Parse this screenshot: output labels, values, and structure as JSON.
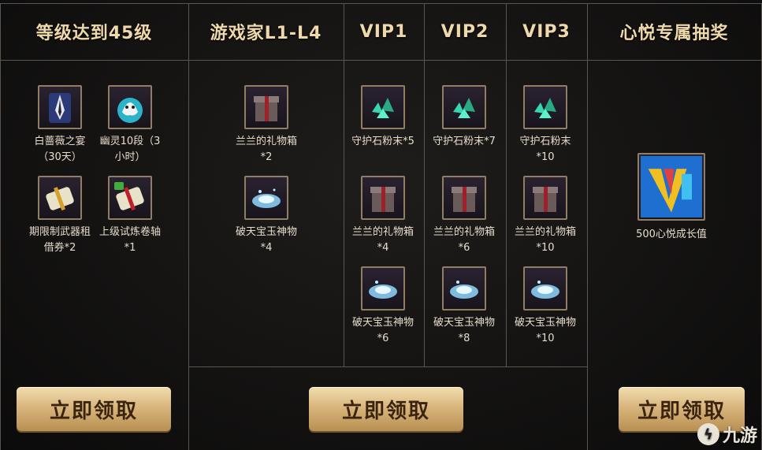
{
  "headers": [
    "等级达到45级",
    "游戏家L1-L4",
    "VIP1",
    "VIP2",
    "VIP3",
    "心悦专属抽奖"
  ],
  "col_level": {
    "items": [
      {
        "icon": "suit-icon",
        "label": "白蔷薇之宴（30天）"
      },
      {
        "icon": "ghost-icon",
        "label": "幽灵10段（3小时）"
      },
      {
        "icon": "scroll-icon",
        "label": "期限制武器租借券*2"
      },
      {
        "icon": "scroll-icon",
        "label": "上级试炼卷轴*1"
      }
    ]
  },
  "col_gamer": {
    "items": [
      {
        "icon": "giftbox-icon",
        "label": "兰兰的礼物箱*2"
      },
      {
        "icon": "jade-icon",
        "label": "破天宝玉神物*4"
      }
    ]
  },
  "col_vip1": {
    "items": [
      {
        "icon": "crystal-icon",
        "label": "守护石粉末*5"
      },
      {
        "icon": "giftbox-icon",
        "label": "兰兰的礼物箱*4"
      },
      {
        "icon": "jade-icon",
        "label": "破天宝玉神物*6"
      }
    ]
  },
  "col_vip2": {
    "items": [
      {
        "icon": "crystal-icon",
        "label": "守护石粉末*7"
      },
      {
        "icon": "giftbox-icon",
        "label": "兰兰的礼物箱*6"
      },
      {
        "icon": "jade-icon",
        "label": "破天宝玉神物*8"
      }
    ]
  },
  "col_vip3": {
    "items": [
      {
        "icon": "crystal-icon",
        "label": "守护石粉末*10"
      },
      {
        "icon": "giftbox-icon",
        "label": "兰兰的礼物箱*10"
      },
      {
        "icon": "jade-icon",
        "label": "破天宝玉神物*10"
      }
    ]
  },
  "col_lottery": {
    "items": [
      {
        "icon": "vip-icon",
        "label": "500心悦成长值"
      }
    ]
  },
  "buttons": {
    "claim_level": "立即领取",
    "claim_vip": "立即领取",
    "claim_lottery": "立即领取"
  },
  "watermark": "九游"
}
